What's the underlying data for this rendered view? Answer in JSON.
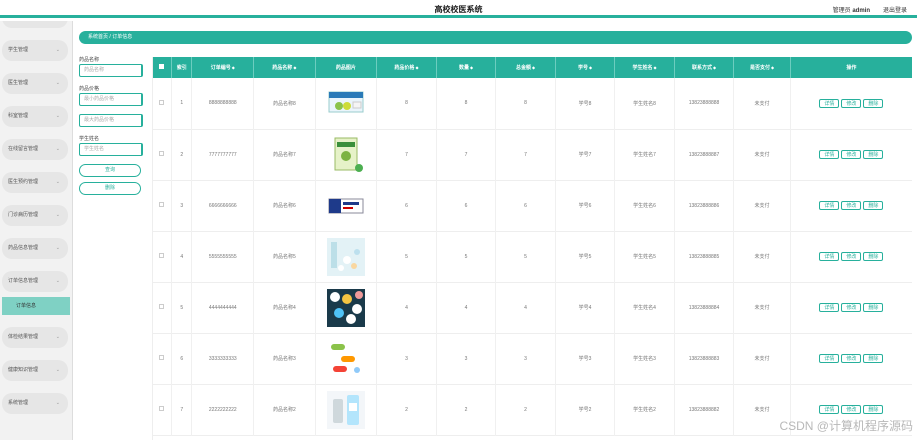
{
  "header": {
    "title": "高校校医系统",
    "user_role": "管理员",
    "user_name": "admin",
    "logout": "退出登录"
  },
  "sidebar": {
    "items": [
      {
        "label": "学生管理"
      },
      {
        "label": "医生管理"
      },
      {
        "label": "科室管理"
      },
      {
        "label": "在线留言管理"
      },
      {
        "label": "医生预约管理"
      },
      {
        "label": "门诊病历管理"
      },
      {
        "label": "药品信息管理"
      },
      {
        "label": "订单信息管理"
      },
      {
        "label": "体检结果管理"
      },
      {
        "label": "健康知识管理"
      },
      {
        "label": "系统管理"
      }
    ],
    "active_sub": "订单信息"
  },
  "breadcrumb": {
    "home": "系统首页",
    "sep": "/",
    "current": "订单信息"
  },
  "filters": {
    "drug_name_label": "药品名称",
    "drug_name_placeholder": "药品名称",
    "price_label": "药品价格",
    "price_min_placeholder": "最小药品价格",
    "price_max_placeholder": "最大药品价格",
    "student_name_label": "学生姓名",
    "student_name_placeholder": "学生姓名",
    "search_btn": "查询",
    "delete_btn": "删除"
  },
  "table": {
    "headers": [
      "索引",
      "订单编号",
      "药品名称",
      "药品图片",
      "药品价格",
      "数量",
      "总金额",
      "学号",
      "学生姓名",
      "联系方式",
      "是否支付",
      "操作"
    ],
    "actions": {
      "detail": "详情",
      "edit": "修改",
      "delete": "删除"
    },
    "rows": [
      {
        "index": "1",
        "order_no": "8888888888",
        "drug": "药品名称8",
        "img": "drug-box-blue",
        "price": "8",
        "qty": "8",
        "total": "8",
        "student_id": "学号8",
        "student_name": "学生姓名8",
        "phone": "13823888888",
        "paid": "未支付"
      },
      {
        "index": "2",
        "order_no": "7777777777",
        "drug": "药品名称7",
        "img": "drug-box-green",
        "price": "7",
        "qty": "7",
        "total": "7",
        "student_id": "学号7",
        "student_name": "学生姓名7",
        "phone": "13823888887",
        "paid": "未支付"
      },
      {
        "index": "3",
        "order_no": "6666666666",
        "drug": "药品名称6",
        "img": "drug-box-navy",
        "price": "6",
        "qty": "6",
        "total": "6",
        "student_id": "学号6",
        "student_name": "学生姓名6",
        "phone": "13823888886",
        "paid": "未支付"
      },
      {
        "index": "4",
        "order_no": "5555555555",
        "drug": "药品名称5",
        "img": "drug-pills-light",
        "price": "5",
        "qty": "5",
        "total": "5",
        "student_id": "学号5",
        "student_name": "学生姓名5",
        "phone": "13823888885",
        "paid": "未支付"
      },
      {
        "index": "5",
        "order_no": "4444444444",
        "drug": "药品名称4",
        "img": "drug-pills-colorful",
        "price": "4",
        "qty": "4",
        "total": "4",
        "student_id": "学号4",
        "student_name": "学生姓名4",
        "phone": "13823888884",
        "paid": "未支付"
      },
      {
        "index": "6",
        "order_no": "3333333333",
        "drug": "药品名称3",
        "img": "drug-capsules",
        "price": "3",
        "qty": "3",
        "total": "3",
        "student_id": "学号3",
        "student_name": "学生姓名3",
        "phone": "13823888883",
        "paid": "未支付"
      },
      {
        "index": "7",
        "order_no": "2222222222",
        "drug": "药品名称2",
        "img": "drug-bottles",
        "price": "2",
        "qty": "2",
        "total": "2",
        "student_id": "学号2",
        "student_name": "学生姓名2",
        "phone": "13823888882",
        "paid": "未支付"
      }
    ]
  },
  "watermark": "CSDN @计算机程序源码",
  "colors": {
    "accent": "#27b09c",
    "active_sub": "#7fd1c4",
    "sidebar_bg": "#f2f2f2"
  }
}
